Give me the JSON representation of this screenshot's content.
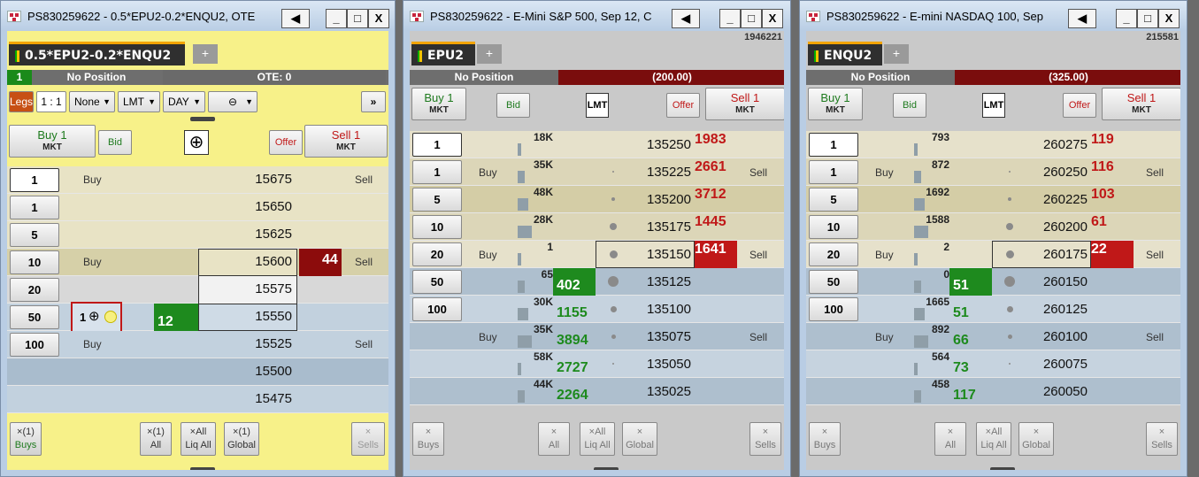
{
  "w1": {
    "title": "PS830259622 - 0.5*EPU2-0.2*ENQU2, OTE",
    "tab": "0.5*EPU2-0.2*ENQU2",
    "add_tab": "+",
    "pos_qty": "1",
    "position": "No Position",
    "ote": "OTE: 0",
    "legs": "Legs",
    "ratio": "1 : 1",
    "none": "None",
    "lmt": "LMT",
    "day": "DAY",
    "more": "»",
    "buy_label": "Buy 1",
    "buy_sub": "MKT",
    "bid": "Bid",
    "offer": "Offer",
    "sell_label": "Sell 1",
    "sell_sub": "MKT",
    "quantities": [
      "1",
      "1",
      "5",
      "10",
      "20",
      "50",
      "100"
    ],
    "prices": [
      "15675",
      "15650",
      "15625",
      "15600",
      "15575",
      "15550",
      "15525",
      "15500",
      "15475"
    ],
    "buy": "Buy",
    "sell": "Sell",
    "ask_44": "44",
    "bid_12": "12",
    "order_qty": "1",
    "buys_btn": "Buys",
    "buys_count": "(1)",
    "all_btn": "All",
    "all_count": "(1)",
    "liq_btn": "Liq All",
    "liq_count": "All",
    "global_btn": "Global",
    "global_count": "(1)",
    "sells_btn": "Sells",
    "close_glyph": "×"
  },
  "w2": {
    "title": "PS830259622 - E-Mini S&P 500, Sep 12, C",
    "account": "1946221",
    "tab": "EPU2",
    "position": "No Position",
    "pnl": "(200.00)",
    "buy_label": "Buy 1",
    "buy_sub": "MKT",
    "bid": "Bid",
    "lmt": "LMT",
    "offer": "Offer",
    "sell_label": "Sell 1",
    "sell_sub": "MKT",
    "quantities": [
      "1",
      "1",
      "5",
      "10",
      "20",
      "50",
      "100"
    ],
    "prices": [
      "135250",
      "135225",
      "135200",
      "135175",
      "135150",
      "135125",
      "135100",
      "135075",
      "135050",
      "135025"
    ],
    "volumes": [
      "18K",
      "35K",
      "48K",
      "28K",
      "1",
      "65",
      "30K",
      "35K",
      "58K",
      "44K"
    ],
    "asks": [
      "1983",
      "2661",
      "3712",
      "1445",
      "1641",
      "",
      "",
      "",
      "",
      ""
    ],
    "bids": [
      "",
      "",
      "",
      "",
      "",
      "402",
      "1155",
      "3894",
      "2727",
      "2264"
    ],
    "order_qty": "1",
    "buys_btn": "Buys",
    "all_btn": "All",
    "liq_btn": "Liq All",
    "global_btn": "Global",
    "sells_btn": "Sells"
  },
  "w3": {
    "title": "PS830259622 - E-mini NASDAQ 100, Sep",
    "account": "215581",
    "tab": "ENQU2",
    "position": "No Position",
    "pnl": "(325.00)",
    "buy_label": "Buy 1",
    "buy_sub": "MKT",
    "bid": "Bid",
    "lmt": "LMT",
    "offer": "Offer",
    "sell_label": "Sell 1",
    "sell_sub": "MKT",
    "quantities": [
      "1",
      "1",
      "5",
      "10",
      "20",
      "50",
      "100"
    ],
    "prices": [
      "260275",
      "260250",
      "260225",
      "260200",
      "260175",
      "260150",
      "260125",
      "260100",
      "260075",
      "260050"
    ],
    "volumes": [
      "793",
      "872",
      "1692",
      "1588",
      "2",
      "0",
      "1665",
      "892",
      "564",
      "458"
    ],
    "asks": [
      "119",
      "116",
      "103",
      "61",
      "22",
      "",
      "",
      "",
      "",
      ""
    ],
    "bids": [
      "",
      "",
      "",
      "",
      "",
      "51",
      "51",
      "66",
      "73",
      "117"
    ],
    "order_qty": "1",
    "buys_btn": "Buys",
    "all_btn": "All",
    "liq_btn": "Liq All",
    "global_btn": "Global",
    "sells_btn": "Sells"
  },
  "common": {
    "buy": "Buy",
    "sell": "Sell",
    "minimize": "_",
    "maximize": "□",
    "close": "X",
    "speaker": "◀"
  },
  "colors": {
    "yellow_bg": "#f7f189",
    "window_frame": "#b9cde4",
    "position_bar": "#6e6e6e",
    "pnl_bar": "#7a0d0d",
    "ask_red": "#c01818",
    "bid_green": "#1d8a1d",
    "buy_cell_bg": "#9fb3c5",
    "sell_cell_bg": "#ded6b8"
  }
}
